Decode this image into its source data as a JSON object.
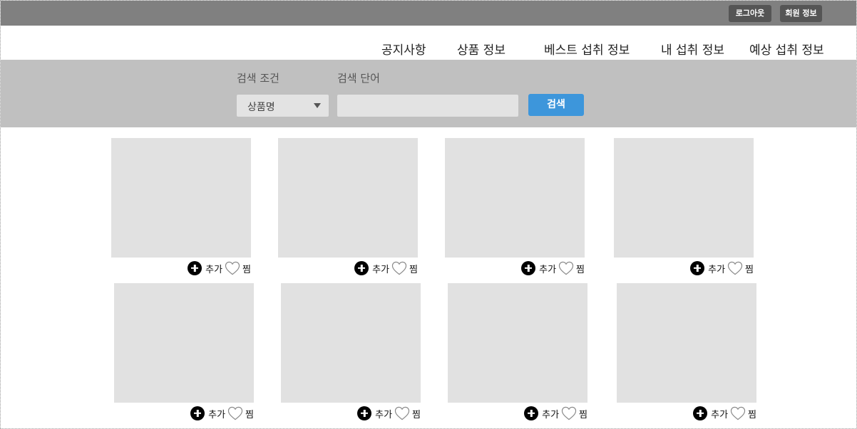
{
  "topbar": {
    "logout_label": "로그아웃",
    "member_info_label": "회원 정보"
  },
  "nav": {
    "items": [
      {
        "label": "공지사항"
      },
      {
        "label": "상품 정보"
      },
      {
        "label": "베스트 섭취 정보"
      },
      {
        "label": "내 섭취 정보"
      },
      {
        "label": "예상 섭취 정보"
      }
    ]
  },
  "search": {
    "condition_label": "검색 조건",
    "keyword_label": "검색 단어",
    "condition_selected": "상품명",
    "keyword_value": "",
    "button_label": "검색"
  },
  "products": [
    {
      "add_label": "추가",
      "wish_label": "찜"
    },
    {
      "add_label": "추가",
      "wish_label": "찜"
    },
    {
      "add_label": "추가",
      "wish_label": "찜"
    },
    {
      "add_label": "추가",
      "wish_label": "찜"
    },
    {
      "add_label": "추가",
      "wish_label": "찜"
    },
    {
      "add_label": "추가",
      "wish_label": "찜"
    },
    {
      "add_label": "추가",
      "wish_label": "찜"
    },
    {
      "add_label": "추가",
      "wish_label": "찜"
    }
  ],
  "colors": {
    "topbar": "#808080",
    "search_bar": "#c0c0c0",
    "search_button": "#3d96db",
    "placeholder_image": "#e1e1e1"
  }
}
